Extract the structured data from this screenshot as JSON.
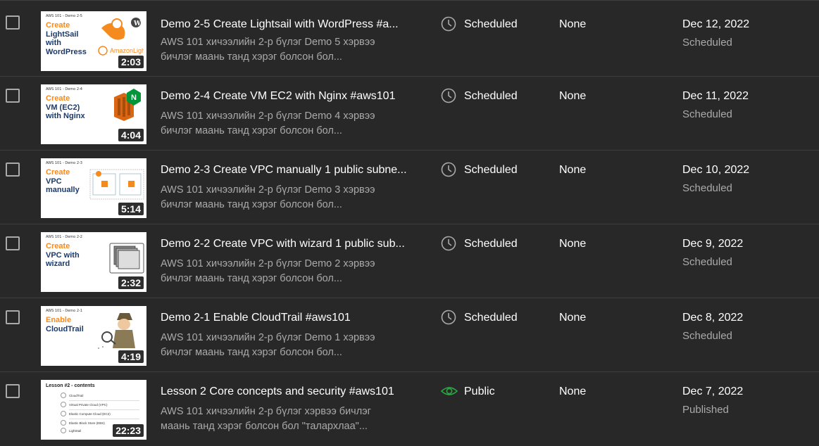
{
  "rows": [
    {
      "thumb": {
        "course": "AWS 101 - Demo 2-5",
        "line1": "Create",
        "line2": "LightSail",
        "line3": "with",
        "line4": "WordPress",
        "duration": "2:03",
        "art": "lightsail-logo"
      },
      "title": "Demo 2-5 Create Lightsail with WordPress #a...",
      "desc_line1": "AWS 101 хичээлийн 2-р бүлэг Demo 5 хэрвээ",
      "desc_line2": "бичлэг маань танд хэрэг болсон бол...",
      "visibility": "Scheduled",
      "visibility_icon": "clock-icon",
      "restrictions": "None",
      "date": "Dec 12, 2022",
      "status": "Scheduled"
    },
    {
      "thumb": {
        "course": "AWS 101 - Demo 2-4",
        "line1": "Create",
        "line2": "VM (EC2)",
        "line3": "with Nginx",
        "duration": "4:04",
        "art": "ec2-nginx-logo"
      },
      "title": "Demo 2-4 Create VM EC2 with Nginx #aws101",
      "desc_line1": "AWS 101 хичээлийн 2-р бүлэг Demo 4 хэрвээ",
      "desc_line2": "бичлэг маань танд хэрэг болсон бол...",
      "visibility": "Scheduled",
      "visibility_icon": "clock-icon",
      "restrictions": "None",
      "date": "Dec 11, 2022",
      "status": "Scheduled"
    },
    {
      "thumb": {
        "course": "AWS 101 - Demo 2-3",
        "line1": "Create",
        "line2": "VPC",
        "line3": "manually",
        "duration": "5:14",
        "art": "vpc-diagram"
      },
      "title": "Demo 2-3 Create VPC manually 1 public subne...",
      "desc_line1": "AWS 101 хичээлийн 2-р бүлэг Demo 3 хэрвээ",
      "desc_line2": "бичлэг маань танд хэрэг болсон бол...",
      "visibility": "Scheduled",
      "visibility_icon": "clock-icon",
      "restrictions": "None",
      "date": "Dec 10, 2022",
      "status": "Scheduled"
    },
    {
      "thumb": {
        "course": "AWS 101 - Demo 2-2",
        "line1": "Create",
        "line2": "VPC with",
        "line3": "wizard",
        "duration": "2:32",
        "art": "vpc-wizard-diagram"
      },
      "title": "Demo 2-2 Create VPC with wizard 1 public sub...",
      "desc_line1": "AWS 101 хичээлийн 2-р бүлэг Demo 2 хэрвээ",
      "desc_line2": "бичлэг маань танд хэрэг болсон бол...",
      "visibility": "Scheduled",
      "visibility_icon": "clock-icon",
      "restrictions": "None",
      "date": "Dec 9, 2022",
      "status": "Scheduled"
    },
    {
      "thumb": {
        "course": "AWS 101 - Demo 2-1",
        "line1": "Enable",
        "line2": "CloudTrail",
        "duration": "4:19",
        "art": "detective-cartoon"
      },
      "title": "Demo 2-1 Enable CloudTrail #aws101",
      "desc_line1": "AWS 101 хичээлийн 2-р бүлэг Demo 1 хэрвээ",
      "desc_line2": "бичлэг маань танд хэрэг болсон бол...",
      "visibility": "Scheduled",
      "visibility_icon": "clock-icon",
      "restrictions": "None",
      "date": "Dec 8, 2022",
      "status": "Scheduled"
    },
    {
      "thumb": {
        "heading": "Lesson #2 - contents",
        "items": [
          "CloudTrail",
          "Virtual Private Cloud (VPC)",
          "Elastic Compute Cloud (EC2)",
          "Elastic Block Store (EBS)",
          "LightSail"
        ],
        "duration": "22:23"
      },
      "title": "Lesson 2 Core concepts and security #aws101",
      "desc_line1": "AWS 101 хичээлийн 2-р бүлэг хэрвээ бичлэг",
      "desc_line2": "маань танд хэрэг болсон бол \"талархлаа\"...",
      "visibility": "Public",
      "visibility_icon": "eye-icon",
      "restrictions": "None",
      "date": "Dec 7, 2022",
      "status": "Published"
    }
  ],
  "colors": {
    "background": "#282828",
    "text_primary": "#ffffff",
    "text_secondary": "#aaaaaa",
    "public_green": "#2ba640",
    "thumb_orange": "#f58a1f",
    "thumb_navy": "#1b3a6b"
  }
}
